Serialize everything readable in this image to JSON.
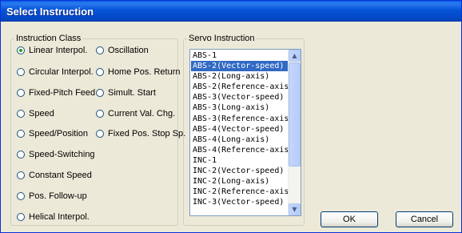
{
  "window": {
    "title": "Select Instruction"
  },
  "instruction_class": {
    "legend": "Instruction Class",
    "options": [
      {
        "label": "Linear Interpol.",
        "selected": true
      },
      {
        "label": "Circular Interpol.",
        "selected": false
      },
      {
        "label": "Fixed-Pitch Feed",
        "selected": false
      },
      {
        "label": "Speed",
        "selected": false
      },
      {
        "label": "Speed/Position",
        "selected": false
      },
      {
        "label": "Speed-Switching",
        "selected": false
      },
      {
        "label": "Constant Speed",
        "selected": false
      },
      {
        "label": "Pos. Follow-up",
        "selected": false
      },
      {
        "label": "Helical Interpol.",
        "selected": false
      },
      {
        "label": "Oscillation",
        "selected": false
      },
      {
        "label": "Home Pos. Return",
        "selected": false
      },
      {
        "label": "Simult. Start",
        "selected": false
      },
      {
        "label": "Current Val. Chg.",
        "selected": false
      },
      {
        "label": "Fixed Pos. Stop Sp.",
        "selected": false
      }
    ]
  },
  "servo_instruction": {
    "legend": "Servo Instruction",
    "selected_item": "ABS-2(Vector-speed)",
    "items": [
      "ABS-1",
      "ABS-2(Vector-speed)",
      "ABS-2(Long-axis)",
      "ABS-2(Reference-axis)",
      "ABS-3(Vector-speed)",
      "ABS-3(Long-axis)",
      "ABS-3(Reference-axis)",
      "ABS-4(Vector-speed)",
      "ABS-4(Long-axis)",
      "ABS-4(Reference-axis)",
      "INC-1",
      "INC-2(Vector-speed)",
      "INC-2(Long-axis)",
      "INC-2(Reference-axis)",
      "INC-3(Vector-speed)"
    ]
  },
  "buttons": {
    "ok": "OK",
    "cancel": "Cancel"
  },
  "icons": {
    "scroll_up": "scroll-up-arrow-icon",
    "scroll_down": "scroll-down-arrow-icon"
  },
  "colors": {
    "title_bar": "#0654d6",
    "selection": "#316ac5",
    "radio_dot": "#21a121"
  }
}
